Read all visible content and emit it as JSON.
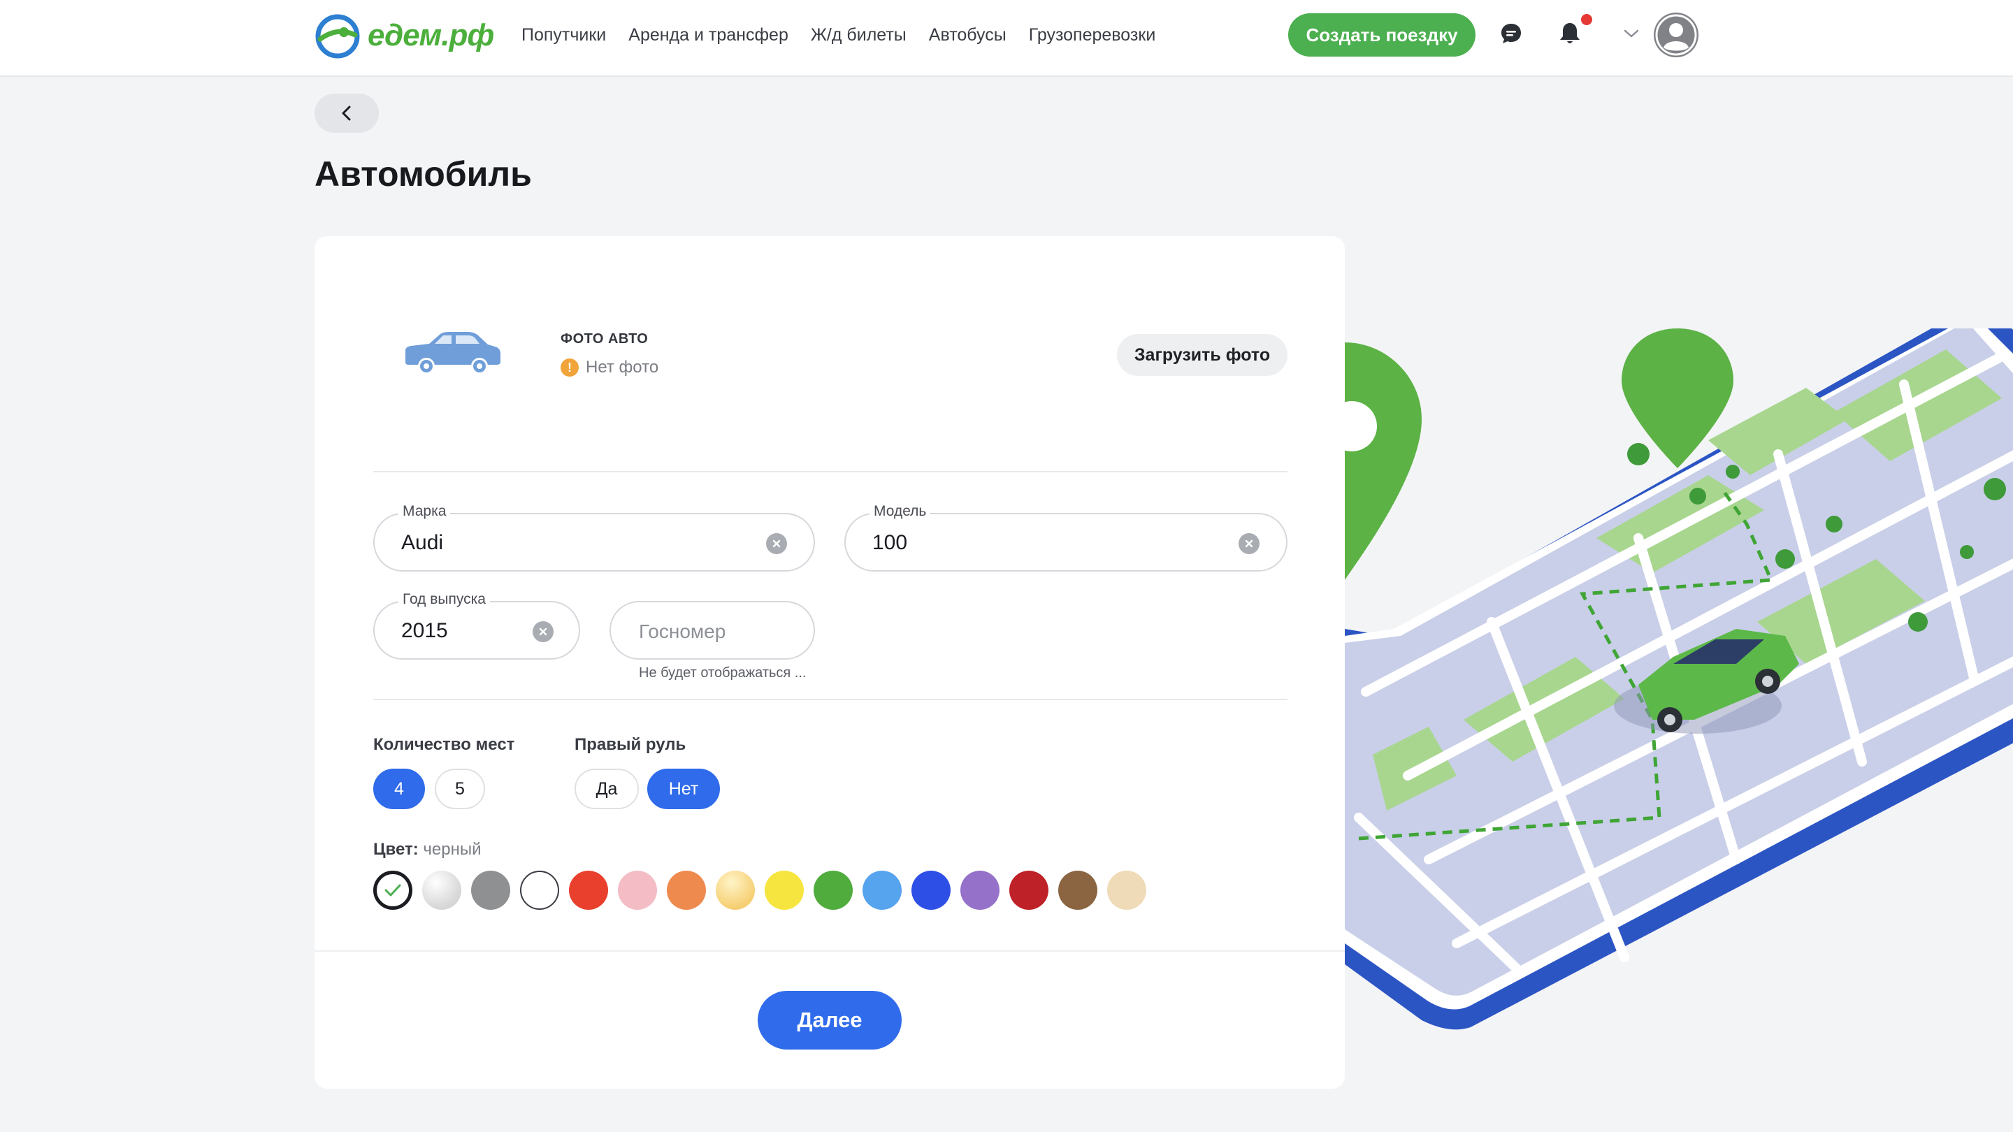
{
  "header": {
    "logo_text": "едем.рф",
    "nav": [
      "Попутчики",
      "Аренда и трансфер",
      "Ж/д билеты",
      "Автобусы",
      "Грузоперевозки"
    ],
    "create_trip": "Создать поездку",
    "has_notification": true
  },
  "page": {
    "title": "Автомобиль"
  },
  "photo": {
    "title": "ФОТО АВТО",
    "status": "Нет фото",
    "upload_button": "Загрузить  фото"
  },
  "fields": {
    "brand": {
      "label": "Марка",
      "value": "Audi"
    },
    "model": {
      "label": "Модель",
      "value": "100"
    },
    "year": {
      "label": "Год выпуска",
      "value": "2015"
    },
    "plate": {
      "placeholder": "Госномер",
      "hint": "Не будет отображаться ..."
    }
  },
  "seats": {
    "label": "Количество мест",
    "options": [
      "4",
      "5"
    ],
    "selected": "4"
  },
  "right_wheel": {
    "label": "Правый руль",
    "options": [
      "Да",
      "Нет"
    ],
    "selected": "Нет"
  },
  "color": {
    "label": "Цвет:",
    "value": "черный",
    "swatches": [
      "#ffffff",
      "#d6d6d6",
      "#8f9092",
      "#ffffff",
      "#e8402c",
      "#f4bcc5",
      "#ef8a4f",
      "#f6cf73",
      "#f6e53f",
      "#4fac3d",
      "#56a3ee",
      "#2e4fe6",
      "#9571c9",
      "#be2127",
      "#8b6441",
      "#efdbb7"
    ],
    "selected_index": 0
  },
  "next_button": "Далее",
  "colors": {
    "brand_green": "#4caf50",
    "primary_blue": "#2f6bea",
    "notification_red": "#e53935"
  }
}
